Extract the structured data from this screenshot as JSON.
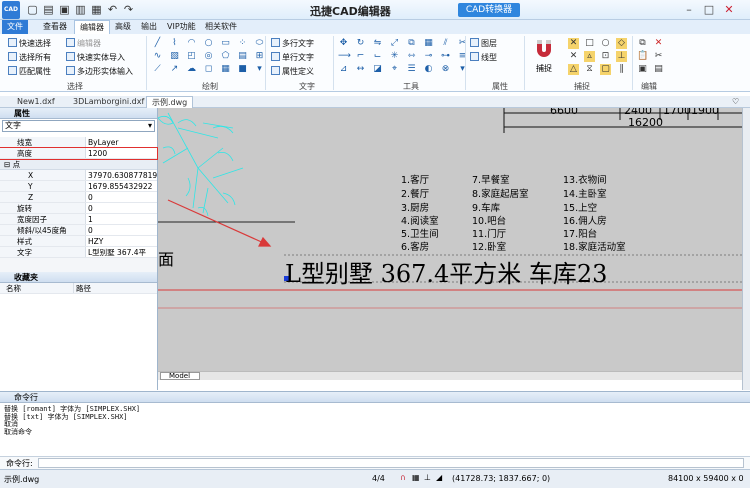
{
  "app": {
    "logo": "CAD",
    "title": "迅捷CAD编辑器",
    "converter": "CAD转换器"
  },
  "menu_tabs": [
    "文件",
    "查看器",
    "编辑器",
    "高级",
    "输出",
    "VIP功能",
    "相关软件"
  ],
  "ribbon": {
    "select": {
      "label": "选择",
      "items": [
        "快速选择",
        "选择所有",
        "匹配属性",
        "编辑器",
        "快速实体导入",
        "多边形实体输入"
      ]
    },
    "draw": {
      "label": "绘制"
    },
    "text": {
      "label": "文字",
      "items": [
        "多行文字",
        "单行文字",
        "属性定义"
      ]
    },
    "tools": {
      "label": "工具"
    },
    "props": {
      "label": "属性",
      "items": [
        "图层",
        "线型"
      ]
    },
    "snap": {
      "label": "捕捉",
      "button": "捕捉"
    },
    "edit": {
      "label": "编辑"
    }
  },
  "doc_tabs": [
    "New1.dxf",
    "3DLamborgini.dxf",
    "示例.dwg"
  ],
  "panel": {
    "title": "属性",
    "selector": "文字",
    "rows": [
      {
        "k": "线宽",
        "v": "ByLayer"
      },
      {
        "k": "高度",
        "v": "1200"
      }
    ],
    "point_cat": "点",
    "point_rows": [
      {
        "k": "X",
        "v": "37970.630877819"
      },
      {
        "k": "Y",
        "v": "1679.855432922"
      },
      {
        "k": "Z",
        "v": "0"
      },
      {
        "k": "旋转",
        "v": "0"
      },
      {
        "k": "宽度因子",
        "v": "1"
      },
      {
        "k": "倾斜/以45度角",
        "v": "0"
      },
      {
        "k": "样式",
        "v": "HZY"
      },
      {
        "k": "文字",
        "v": "L型别墅    367.4平"
      }
    ],
    "fav_title": "收藏夹",
    "fav_cols": [
      "名称",
      "路径"
    ]
  },
  "drawing": {
    "dims": [
      "6600",
      "2400",
      "1700",
      "1900",
      "16200"
    ],
    "legend_col1": [
      "1.客厅",
      "2.餐厅",
      "3.厨房",
      "4.阅读室",
      "5.卫生间",
      "6.客房"
    ],
    "legend_col2": [
      "7.早餐室",
      "8.家庭起居室",
      "9.车库",
      "10.吧台",
      "11.门厅",
      "12.卧室"
    ],
    "legend_col3": [
      "13.衣物间",
      "14.主卧室",
      "15.上空",
      "16.佣人房",
      "17.阳台",
      "18.家庭活动室"
    ],
    "big_text": "L型别墅      367.4平方米     车库23",
    "left_char": "面",
    "model_tab": "Model"
  },
  "command": {
    "title": "命令行",
    "lines": [
      "替换 [romant] 字体为 [SIMPLEX.SHX]",
      "替换 [txt] 字体为 [SIMPLEX.SHX]",
      "取消",
      "取消命令"
    ],
    "prompt": "命令行:"
  },
  "status": {
    "file": "示例.dwg",
    "pages": "4/4",
    "coords": "(41728.73; 1837.667; 0)",
    "size": "84100 x 59400 x 0"
  },
  "colors": {
    "accent": "#2f7bd6",
    "cyan_tree": "#2ee6e6",
    "red_line": "#d93a3a"
  }
}
